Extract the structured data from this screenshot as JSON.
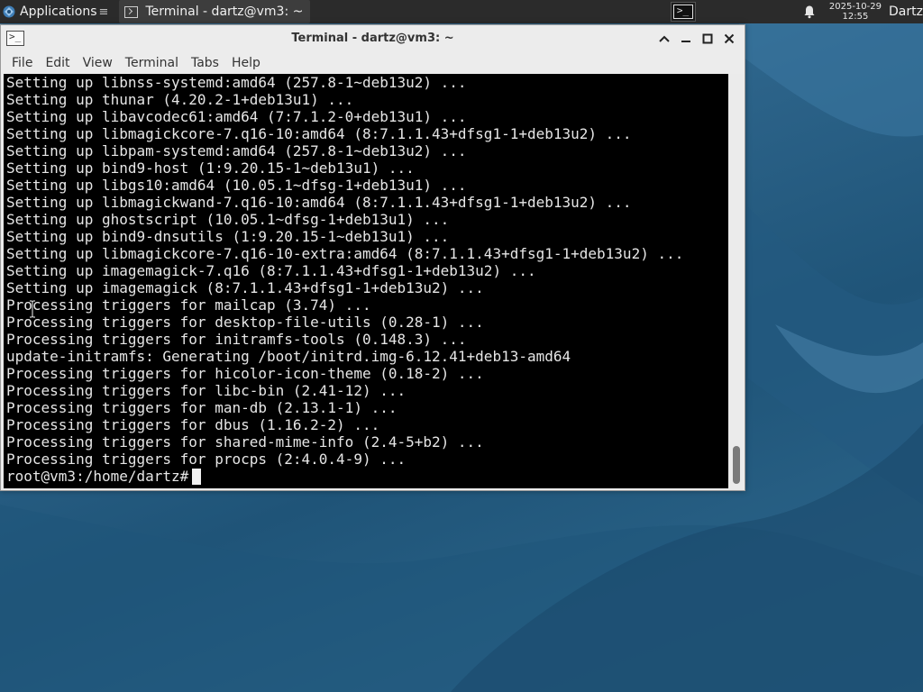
{
  "panel": {
    "applications_label": "Applications",
    "applications_separator": "≡",
    "task_label": "Terminal - dartz@vm3: ~",
    "clock_date": "2025-10-29",
    "clock_time": "12:55",
    "user_label": "Dartz"
  },
  "window": {
    "title": "Terminal - dartz@vm3: ~",
    "menu": [
      "File",
      "Edit",
      "View",
      "Terminal",
      "Tabs",
      "Help"
    ]
  },
  "terminal": {
    "lines": [
      "Setting up libnss-systemd:amd64 (257.8-1~deb13u2) ...",
      "Setting up thunar (4.20.2-1+deb13u1) ...",
      "Setting up libavcodec61:amd64 (7:7.1.2-0+deb13u1) ...",
      "Setting up libmagickcore-7.q16-10:amd64 (8:7.1.1.43+dfsg1-1+deb13u2) ...",
      "Setting up libpam-systemd:amd64 (257.8-1~deb13u2) ...",
      "Setting up bind9-host (1:9.20.15-1~deb13u1) ...",
      "Setting up libgs10:amd64 (10.05.1~dfsg-1+deb13u1) ...",
      "Setting up libmagickwand-7.q16-10:amd64 (8:7.1.1.43+dfsg1-1+deb13u2) ...",
      "Setting up ghostscript (10.05.1~dfsg-1+deb13u1) ...",
      "Setting up bind9-dnsutils (1:9.20.15-1~deb13u1) ...",
      "Setting up libmagickcore-7.q16-10-extra:amd64 (8:7.1.1.43+dfsg1-1+deb13u2) ...",
      "Setting up imagemagick-7.q16 (8:7.1.1.43+dfsg1-1+deb13u2) ...",
      "Setting up imagemagick (8:7.1.1.43+dfsg1-1+deb13u2) ...",
      "Processing triggers for mailcap (3.74) ...",
      "Processing triggers for desktop-file-utils (0.28-1) ...",
      "Processing triggers for initramfs-tools (0.148.3) ...",
      "update-initramfs: Generating /boot/initrd.img-6.12.41+deb13-amd64",
      "Processing triggers for hicolor-icon-theme (0.18-2) ...",
      "Processing triggers for libc-bin (2.41-12) ...",
      "Processing triggers for man-db (2.13.1-1) ...",
      "Processing triggers for dbus (1.16.2-2) ...",
      "Processing triggers for shared-mime-info (2.4-5+b2) ...",
      "Processing triggers for procps (2:4.0.4-9) ..."
    ],
    "prompt": "root@vm3:/home/dartz#"
  },
  "icons": {
    "applications": "apps-grid-icon",
    "task": "terminal-icon",
    "launcher": "terminal-launcher-icon",
    "notifications": "bell-icon",
    "title": "terminal-icon",
    "minimize_up": "chevron-up-icon",
    "minimize": "minimize-icon",
    "maximize": "maximize-icon",
    "close": "close-icon"
  },
  "colors": {
    "panel_bg": "#2b2b2b",
    "terminal_bg": "#000000",
    "terminal_fg": "#e6e6e6",
    "window_chrome": "#ececec",
    "desktop_blue": "#2c6389"
  }
}
